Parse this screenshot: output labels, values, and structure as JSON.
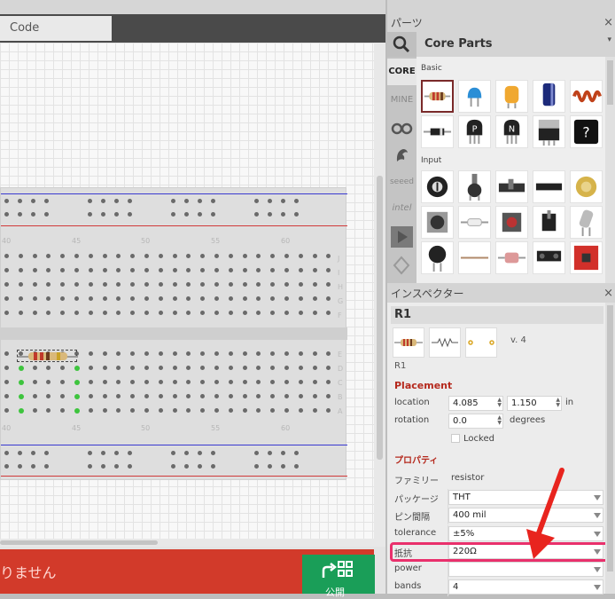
{
  "editor": {
    "code_tab": "Code",
    "breadboard": {
      "col_numbers_top": [
        "40",
        "45",
        "50",
        "55",
        "60"
      ],
      "col_numbers_bottom": [
        "40",
        "45",
        "50",
        "55",
        "60"
      ],
      "row_letters_top": [
        "J",
        "I",
        "H",
        "G",
        "F"
      ],
      "row_letters_bottom": [
        "E",
        "D",
        "C",
        "B",
        "A"
      ]
    },
    "status_message": "りません",
    "share_label": "公開",
    "share_icon": "share-icon"
  },
  "parts_panel": {
    "title": "パーツ",
    "close": "×",
    "bin_title": "Core Parts",
    "menu": "▾",
    "bins": [
      "CORE",
      "MINE",
      "arduino-icon",
      "fritzing-icon",
      "seeed",
      "intel",
      "play-icon",
      "sparkfun-icon"
    ],
    "bin_labels": {
      "core": "CORE",
      "mine": "MINE",
      "seeed": "seeed",
      "intel": "intel"
    },
    "sections": [
      "Basic",
      "Input"
    ],
    "parts_basic_row1": [
      "resistor",
      "ceramic-capacitor",
      "tantalum-capacitor",
      "electrolytic-capacitor",
      "inductor"
    ],
    "parts_basic_row2": [
      "diode",
      "pnp-transistor",
      "npn-transistor",
      "fet-transistor",
      "mystery-part"
    ],
    "parts_input_row1": [
      "potentiometer",
      "rotary-potentiometer",
      "slide-potentiometer",
      "header",
      "piezo-speaker"
    ],
    "parts_input_row2": [
      "rotary-encoder",
      "reed-switch",
      "pushbutton",
      "toggle-switch",
      "tilt-switch"
    ],
    "parts_input_row3": [
      "photocell",
      "wire",
      "temperature-sensor",
      "ir-sensor",
      "accelerometer-board"
    ]
  },
  "inspector": {
    "title": "インスペクター",
    "close": "×",
    "part_title": "R1",
    "version": "v. 4",
    "label": "R1",
    "placement_header": "Placement",
    "location_label": "location",
    "location_x": "4.085",
    "location_y": "1.150",
    "location_unit": "in",
    "rotation_label": "rotation",
    "rotation_value": "0.0",
    "rotation_unit": "degrees",
    "locked_label": "Locked",
    "properties_header": "プロパティ",
    "family_label": "ファミリー",
    "family_value": "resistor",
    "package_label": "パッケージ",
    "package_value": "THT",
    "pin_spacing_label": "ピン間隔",
    "pin_spacing_value": "400 mil",
    "tolerance_label": "tolerance",
    "tolerance_value": "±5%",
    "resistance_label": "抵抗",
    "resistance_value": "220Ω",
    "power_label": "power",
    "power_value": "",
    "bands_label": "bands",
    "bands_value": "4"
  },
  "colors": {
    "accent_red": "#b5291d",
    "error_bar": "#d23a2a",
    "share_green": "#1a9e58",
    "highlight": "#e9306c",
    "arrow": "#e8241e"
  }
}
